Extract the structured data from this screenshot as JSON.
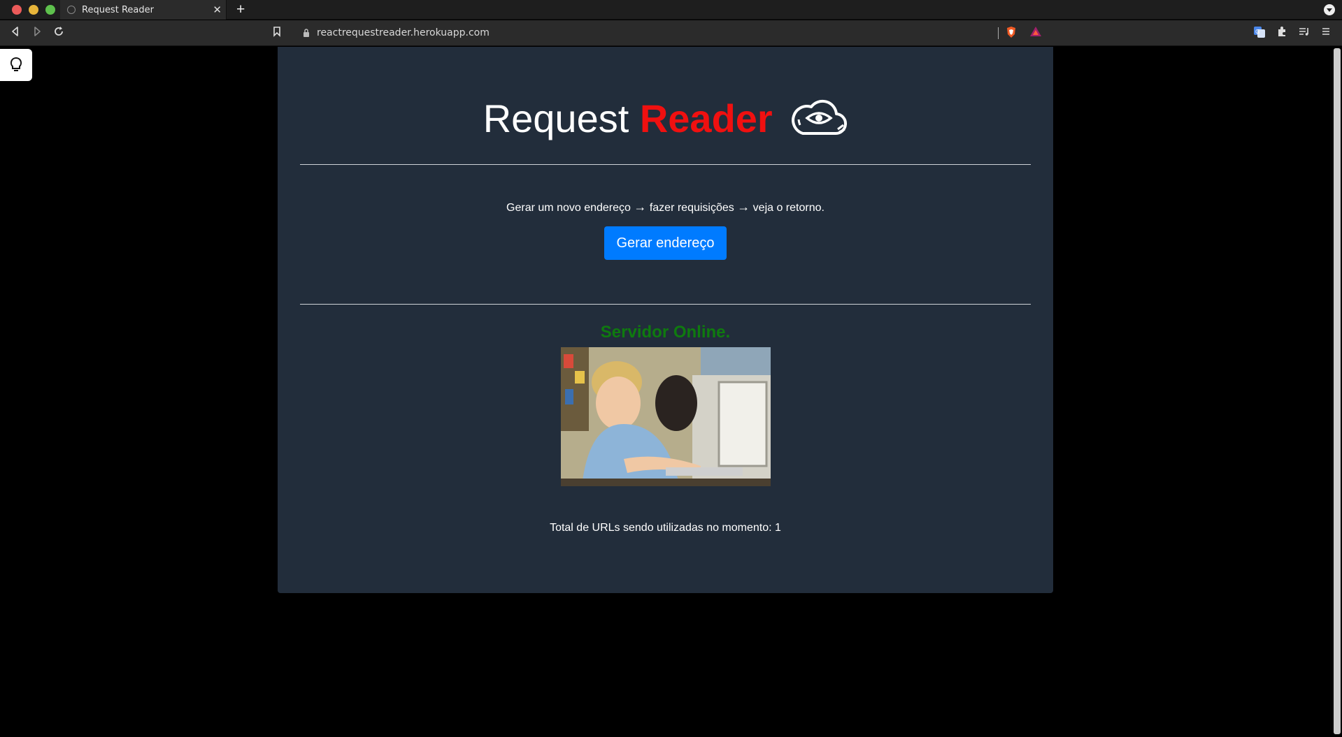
{
  "browser": {
    "tab_title": "Request Reader",
    "tab_close": "✕",
    "new_tab": "+",
    "url": "reactrequestreader.herokuapp.com"
  },
  "page": {
    "title_part1": "Request ",
    "title_part2": "Reader",
    "subtitle_step1": "Gerar um novo endereço ",
    "subtitle_arrow": "→",
    "subtitle_step2": " fazer requisições ",
    "subtitle_step3": " veja o retorno.",
    "generate_button": "Gerar endereço",
    "status": "Servidor Online.",
    "total_urls": "Total de URLs sendo utilizadas no momento: 1"
  },
  "colors": {
    "card_bg": "#222d3b",
    "accent_red": "#f01010",
    "button_blue": "#007bff",
    "status_green": "#0f7a0f"
  }
}
